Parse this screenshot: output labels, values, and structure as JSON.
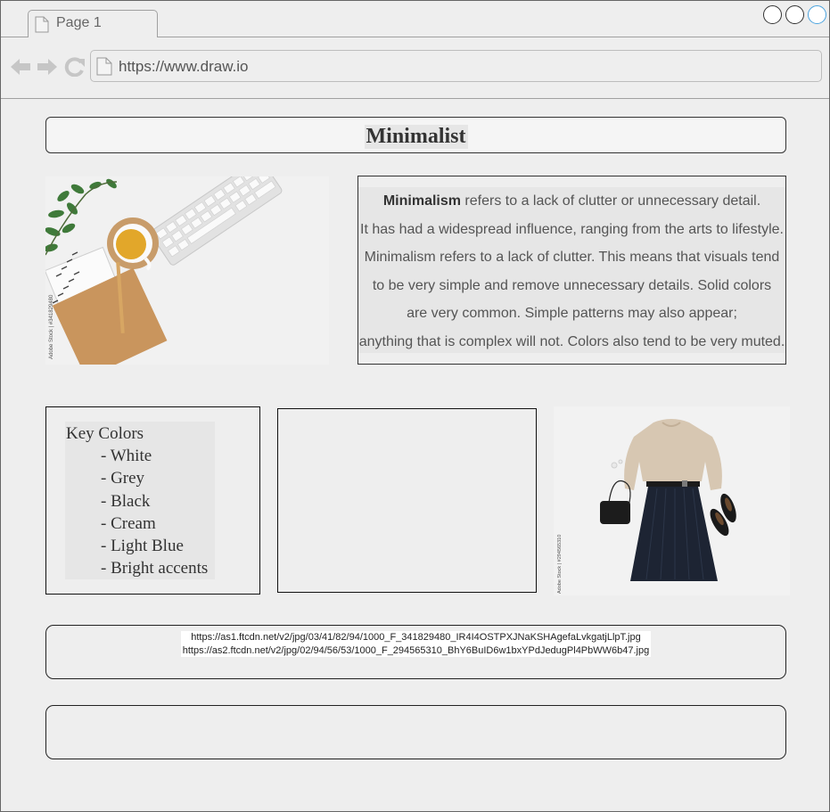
{
  "browser": {
    "tab_label": "Page 1",
    "url": "https://www.draw.io",
    "accent_color": "#4aa3df"
  },
  "icons": {
    "tab_page": "page-icon",
    "back": "arrow-left-icon",
    "forward": "arrow-right-icon",
    "reload": "reload-icon",
    "url_page": "page-icon"
  },
  "header": {
    "title": "Minimalist"
  },
  "description": {
    "lead_bold": "Minimalism",
    "lead_rest": " refers to a lack of clutter or unnecessary detail.",
    "lines": [
      "It has had a widespread influence, ranging from the arts to lifestyle.",
      "Minimalism refers to a lack of clutter. This means that visuals tend",
      "to be very simple and remove unnecessary details. Solid colors",
      "are very common. Simple patterns may also appear;",
      "anything that is complex will not. Colors also tend to be very muted."
    ]
  },
  "key_colors": {
    "heading": "Key Colors",
    "items": [
      "- White",
      "- Grey",
      "- Black",
      "- Cream",
      "- Light Blue",
      "- Bright accents"
    ]
  },
  "sources": {
    "lines": [
      "https://as1.ftcdn.net/v2/jpg/03/41/82/94/1000_F_341829480_IR4I4OSTPXJNaKSHAgefaLvkgatjLlpT.jpg",
      "https://as2.ftcdn.net/v2/jpg/02/94/56/53/1000_F_294565310_BhY6BuID6w1bxYPdJedugPl4PbWW6b47.jpg"
    ]
  },
  "images": {
    "desk": {
      "watermark": "Adobe Stock | #341829480"
    },
    "outfit": {
      "watermark": "Adobe Stock | #294565310"
    }
  }
}
